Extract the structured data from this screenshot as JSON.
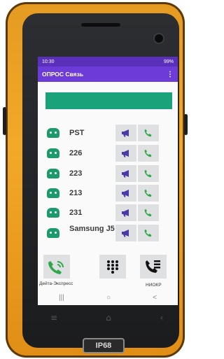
{
  "device": {
    "model_badge": "IP68"
  },
  "statusbar": {
    "time": "10:30",
    "battery": "99%"
  },
  "app": {
    "title": "ОПРОС Связь",
    "overflow_icon": "⋮"
  },
  "contacts": [
    {
      "name": "PST"
    },
    {
      "name": "226"
    },
    {
      "name": "223"
    },
    {
      "name": "213"
    },
    {
      "name": "231"
    },
    {
      "name": "Samsung J5"
    }
  ],
  "dock": {
    "left_label": "Дейта-Экспресс",
    "right_label": "НИОКР"
  },
  "colors": {
    "statusbar": "#5a2fb9",
    "appbar": "#6d3cd8",
    "banner": "#1aa37a",
    "icon_green": "#1b9a6b",
    "megaphone": "#4a3aa8",
    "call_green": "#2fa84a"
  }
}
